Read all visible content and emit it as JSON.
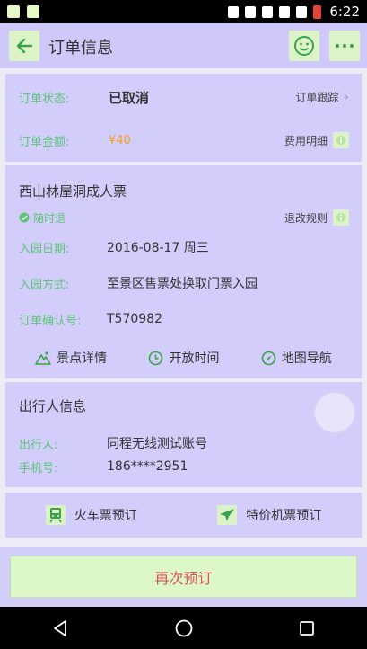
{
  "status_bar": {
    "time": "6:22"
  },
  "header": {
    "title": "订单信息"
  },
  "order": {
    "status_label": "订单状态:",
    "status_value": "已取消",
    "track_label": "订单跟踪",
    "amount_label": "订单金额:",
    "amount_value": "¥40",
    "fee_detail_label": "费用明细"
  },
  "ticket": {
    "name": "西山林屋洞成人票",
    "refund_flag": "随时退",
    "refund_rule": "退改规则",
    "date_label": "入园日期:",
    "date_value": "2016-08-17 周三",
    "entry_label": "入园方式:",
    "entry_value": "至景区售票处换取门票入园",
    "confirm_label": "订单确认号:",
    "confirm_value": "T570982",
    "actions": [
      "景点详情",
      "开放时间",
      "地图导航"
    ]
  },
  "traveler": {
    "title": "出行人信息",
    "name_label": "出行人:",
    "name_value": "同程无线测试账号",
    "phone_label": "手机号:",
    "phone_value": "186****2951"
  },
  "booking": {
    "train": "火车票预订",
    "flight": "特价机票预订"
  },
  "footer": {
    "rebook": "再次预订"
  }
}
